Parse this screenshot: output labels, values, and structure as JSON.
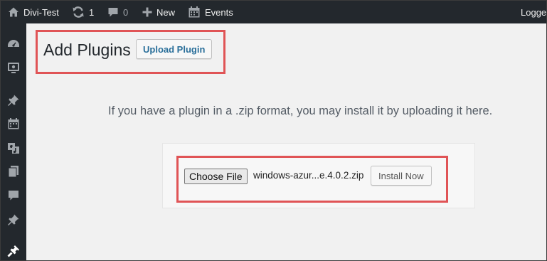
{
  "adminbar": {
    "site_name": "Divi-Test",
    "updates_count": "1",
    "comments_count": "0",
    "new_label": "New",
    "events_label": "Events",
    "account_label": "Logge"
  },
  "sidebar": {
    "items": [
      {
        "icon": "dashboard-icon"
      },
      {
        "icon": "divi-icon"
      },
      {
        "icon": "pin-icon"
      },
      {
        "icon": "calendar-icon"
      },
      {
        "icon": "media-icon"
      },
      {
        "icon": "pages-icon"
      },
      {
        "icon": "comments-icon"
      },
      {
        "icon": "pin-icon"
      },
      {
        "icon": "plugins-icon"
      }
    ]
  },
  "main": {
    "title": "Add Plugins",
    "upload_button": "Upload Plugin",
    "help_text": "If you have a plugin in a .zip format, you may install it by uploading it here.",
    "choose_file_button": "Choose File",
    "file_name": "windows-azur...e.4.0.2.zip",
    "install_button": "Install Now"
  },
  "colors": {
    "admin_bar_bg": "#23282d",
    "highlight": "#e05456",
    "link_blue": "#2a6f9a",
    "background": "#f1f1f1"
  }
}
